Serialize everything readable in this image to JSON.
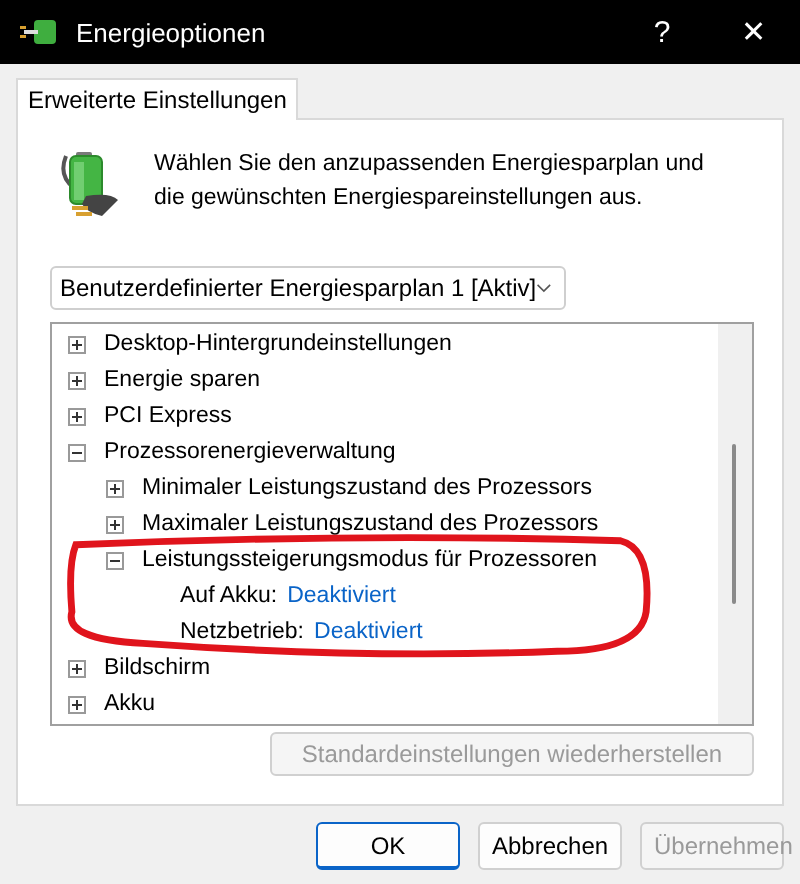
{
  "window": {
    "title": "Energieoptionen",
    "help": "?",
    "close": "✕"
  },
  "tabs": [
    {
      "label": "Erweiterte Einstellungen",
      "selected": true
    }
  ],
  "description": "Wählen Sie den anzupassenden Energiesparplan und die gewünschten Energiespareinstellungen aus.",
  "plan_dropdown": {
    "value": "Benutzerdefinierter Energiesparplan 1 [Aktiv]"
  },
  "tree": [
    {
      "kind": "group",
      "label": "Desktop-Hintergrundeinstellungen",
      "expanded": false
    },
    {
      "kind": "group",
      "label": "Energie sparen",
      "expanded": false
    },
    {
      "kind": "group",
      "label": "PCI Express",
      "expanded": false
    },
    {
      "kind": "group",
      "label": "Prozessorenergieverwaltung",
      "expanded": true,
      "children": [
        {
          "kind": "group",
          "label": "Minimaler Leistungszustand des Prozessors",
          "expanded": false
        },
        {
          "kind": "group",
          "label": "Maximaler Leistungszustand des Prozessors",
          "expanded": false
        },
        {
          "kind": "group",
          "label": "Leistungssteigerungsmodus für Prozessoren",
          "expanded": true,
          "children": [
            {
              "kind": "setting",
              "label": "Auf Akku:",
              "value": "Deaktiviert"
            },
            {
              "kind": "setting",
              "label": "Netzbetrieb:",
              "value": "Deaktiviert"
            }
          ]
        }
      ]
    },
    {
      "kind": "group",
      "label": "Bildschirm",
      "expanded": false
    },
    {
      "kind": "group",
      "label": "Akku",
      "expanded": false
    }
  ],
  "restore_button": {
    "label": "Standardeinstellungen wiederherstellen",
    "disabled": true
  },
  "buttons": [
    {
      "label": "OK",
      "default": true,
      "disabled": false
    },
    {
      "label": "Abbrechen",
      "default": false,
      "disabled": false
    },
    {
      "label": "Übernehmen",
      "default": false,
      "disabled": true
    }
  ]
}
